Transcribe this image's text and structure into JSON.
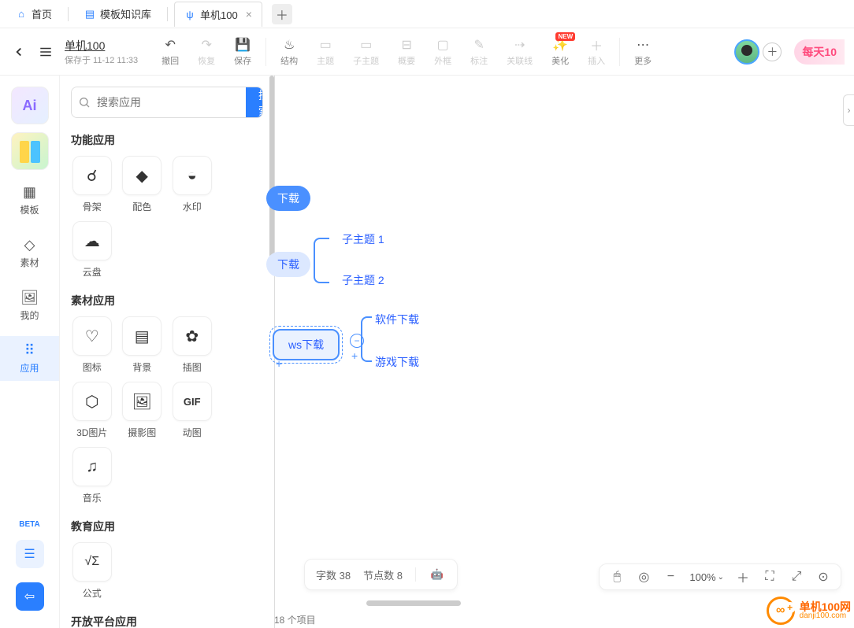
{
  "tabs": {
    "home": "首页",
    "templates": "模板知识库",
    "doc": "单机100"
  },
  "doc": {
    "title": "单机100",
    "saved_at": "保存于 11-12 11:33"
  },
  "toolbar": {
    "undo": "撤回",
    "redo": "恢复",
    "save": "保存",
    "structure": "结构",
    "topic": "主题",
    "subtopic": "子主题",
    "summary": "概要",
    "frame": "外框",
    "note": "标注",
    "relation": "关联线",
    "beautify": "美化",
    "insert": "插入",
    "more": "更多",
    "badge_new": "NEW",
    "banner": "每天10"
  },
  "rail": {
    "ai": "Ai",
    "templates": "模板",
    "assets": "素材",
    "mine": "我的",
    "apps": "应用",
    "beta": "BETA"
  },
  "panel": {
    "search_placeholder": "搜索应用",
    "search_btn": "搜 索",
    "sec_func": "功能应用",
    "sec_asset": "素材应用",
    "sec_edu": "教育应用",
    "sec_open": "开放平台应用",
    "tiles": {
      "skeleton": "骨架",
      "palette": "配色",
      "watermark": "水印",
      "cloud": "云盘",
      "icons": "图标",
      "background": "背景",
      "illustration": "插图",
      "img3d": "3D图片",
      "photo": "摄影图",
      "gif": "动图",
      "music": "音乐",
      "formula": "公式"
    }
  },
  "mindmap": {
    "n1": "下载",
    "n2": "下载",
    "n2a": "子主题 1",
    "n2b": "子主题 2",
    "n3": "ws下载",
    "n3a": "软件下载",
    "n3b": "游戏下载"
  },
  "status": {
    "words_label": "字数",
    "words": "38",
    "nodes_label": "节点数",
    "nodes": "8"
  },
  "zoom": {
    "value": "100%"
  },
  "watermark": {
    "cn": "单机100网",
    "en": "danji100.com"
  },
  "footer_peek": "18 个项目"
}
